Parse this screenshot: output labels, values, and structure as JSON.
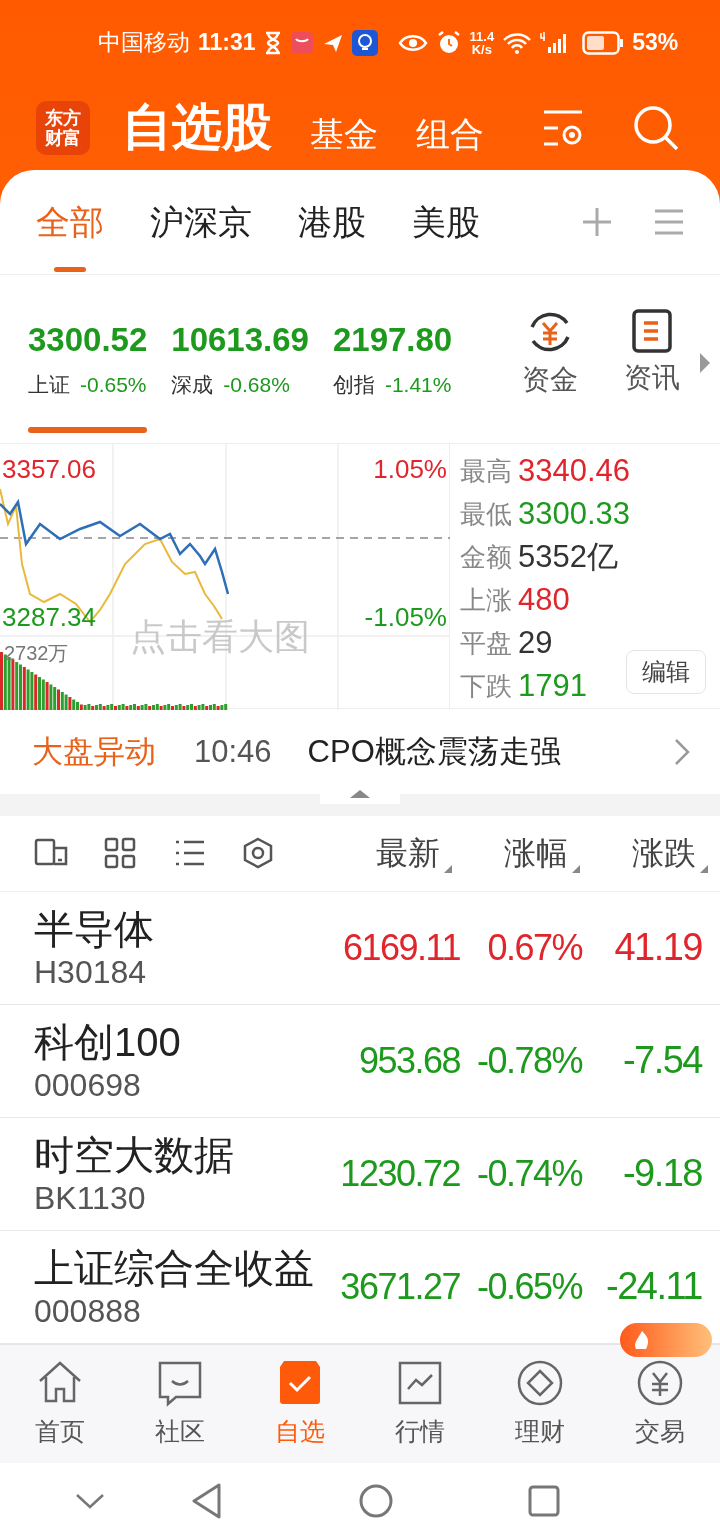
{
  "status_bar": {
    "carrier": "中国移动",
    "time": "11:31",
    "net_speed": "11.4",
    "net_unit": "K/s",
    "battery": "53%"
  },
  "header": {
    "logo_lines": [
      "东方",
      "财富"
    ],
    "title": "自选股",
    "links": [
      "基金",
      "组合"
    ]
  },
  "tabs": [
    {
      "label": "全部",
      "selected": true
    },
    {
      "label": "沪深京",
      "selected": false
    },
    {
      "label": "港股",
      "selected": false
    },
    {
      "label": "美股",
      "selected": false
    }
  ],
  "indices": [
    {
      "value": "3300.52",
      "name": "上证",
      "change": "-0.65%",
      "color": "#1d9a1d",
      "selected": true
    },
    {
      "value": "10613.69",
      "name": "深成",
      "change": "-0.68%",
      "color": "#1d9a1d",
      "selected": false
    },
    {
      "value": "2197.80",
      "name": "创指",
      "change": "-1.41%",
      "color": "#1d9a1d",
      "selected": false
    }
  ],
  "tools": [
    {
      "label": "资金",
      "kind": "fund"
    },
    {
      "label": "资讯",
      "kind": "news"
    }
  ],
  "chart": {
    "high_price": "3357.06",
    "low_price": "3287.34",
    "high_pct": "1.05%",
    "low_pct": "-1.05%",
    "volume": "2732万",
    "hint": "点击看大图"
  },
  "stats": [
    {
      "label": "最高",
      "value": "3340.46",
      "color": "#e0262d"
    },
    {
      "label": "最低",
      "value": "3300.33",
      "color": "#1d9a1d"
    },
    {
      "label": "金额",
      "value": "5352亿",
      "color": "#333333"
    },
    {
      "label": "上涨",
      "value": "480",
      "color": "#e0262d"
    },
    {
      "label": "平盘",
      "value": "29",
      "color": "#333333"
    },
    {
      "label": "下跌",
      "value": "1791",
      "color": "#1d9a1d"
    }
  ],
  "edit_button": "编辑",
  "alert": {
    "title": "大盘异动",
    "time": "10:46",
    "text": "CPO概念震荡走强"
  },
  "columns": [
    "最新",
    "涨幅",
    "涨跌"
  ],
  "rows": [
    {
      "name": "半导体",
      "code": "H30184",
      "price": "6169.11",
      "pct": "0.67%",
      "change": "41.19",
      "color": "#e0262d"
    },
    {
      "name": "科创100",
      "code": "000698",
      "price": "953.68",
      "pct": "-0.78%",
      "change": "-7.54",
      "color": "#1d9a1d"
    },
    {
      "name": "时空大数据",
      "code": "BK1130",
      "price": "1230.72",
      "pct": "-0.74%",
      "change": "-9.18",
      "color": "#1d9a1d"
    },
    {
      "name": "上证综合全收益",
      "code": "000888",
      "price": "3671.27",
      "pct": "-0.65%",
      "change": "-24.11",
      "color": "#1d9a1d"
    }
  ],
  "bottom_nav": [
    {
      "label": "首页",
      "kind": "home",
      "selected": false
    },
    {
      "label": "社区",
      "kind": "community",
      "selected": false
    },
    {
      "label": "自选",
      "kind": "watchlist",
      "selected": true
    },
    {
      "label": "行情",
      "kind": "market",
      "selected": false
    },
    {
      "label": "理财",
      "kind": "wealth",
      "selected": false
    },
    {
      "label": "交易",
      "kind": "trade",
      "selected": false
    }
  ]
}
